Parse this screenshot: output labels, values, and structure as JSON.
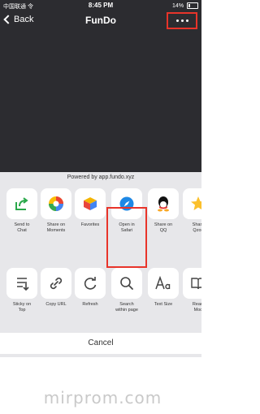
{
  "status_bar": {
    "carrier": "中国联通 令",
    "time": "8:45 PM",
    "battery": "14%"
  },
  "nav": {
    "back_label": "Back",
    "title": "FunDo"
  },
  "sheet": {
    "powered_by": "Powered by app.fundo.xyz",
    "share_items": [
      {
        "label": "Send to\nChat",
        "icon": "send-to-chat-icon"
      },
      {
        "label": "Share on\nMoments",
        "icon": "moments-icon"
      },
      {
        "label": "Favorites",
        "icon": "favorites-icon"
      },
      {
        "label": "Open in\nSafari",
        "icon": "safari-icon"
      },
      {
        "label": "Share on\nQQ",
        "icon": "qq-icon"
      },
      {
        "label": "Share\nQzon",
        "icon": "qzone-icon"
      }
    ],
    "action_items": [
      {
        "label": "Sticky on\nTop",
        "icon": "sticky-icon"
      },
      {
        "label": "Copy URL",
        "icon": "link-icon"
      },
      {
        "label": "Refresh",
        "icon": "refresh-icon"
      },
      {
        "label": "Search\nwithin page",
        "icon": "search-icon"
      },
      {
        "label": "Text Size",
        "icon": "text-size-icon"
      },
      {
        "label": "Readi\nMod",
        "icon": "reading-mode-icon"
      }
    ],
    "cancel_label": "Cancel"
  },
  "colors": {
    "highlight": "#e8342a",
    "background": "#2c2c30"
  },
  "watermark": "mirprom.com"
}
